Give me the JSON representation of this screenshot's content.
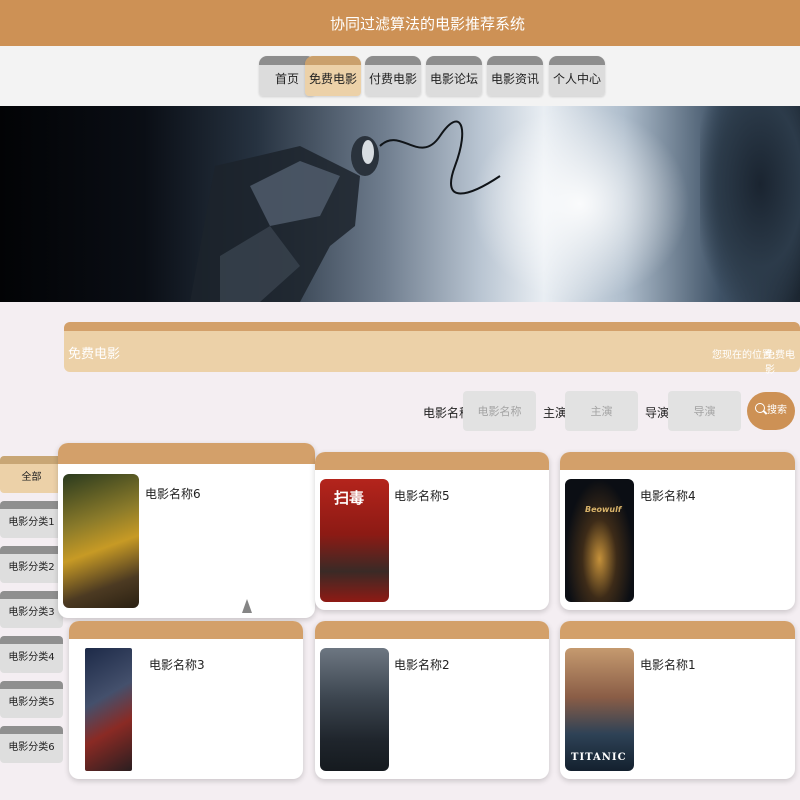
{
  "header": {
    "title": "协同过滤算法的电影推荐系统"
  },
  "nav": {
    "items": [
      {
        "label": "首页"
      },
      {
        "label": "免费电影",
        "active": true
      },
      {
        "label": "付费电影"
      },
      {
        "label": "电影论坛"
      },
      {
        "label": "电影资讯"
      },
      {
        "label": "个人中心"
      }
    ]
  },
  "section": {
    "title": "免费电影",
    "breadcrumb_label": "您现在的位置:",
    "breadcrumb_value": "免费电影"
  },
  "search": {
    "name_label": "电影名称",
    "name_placeholder": "电影名称",
    "actor_label": "主演",
    "actor_placeholder": "主演",
    "director_label": "导演",
    "director_placeholder": "导演",
    "button_label": "搜索"
  },
  "categories": [
    {
      "label": "全部",
      "active": true
    },
    {
      "label": "电影分类1"
    },
    {
      "label": "电影分类2"
    },
    {
      "label": "电影分类3"
    },
    {
      "label": "电影分类4"
    },
    {
      "label": "电影分类5"
    },
    {
      "label": "电影分类6"
    }
  ],
  "movies": [
    {
      "name": "电影名称6"
    },
    {
      "name": "电影名称5",
      "poster_text": "扫毒"
    },
    {
      "name": "电影名称4",
      "poster_text": "Beowulf"
    },
    {
      "name": "电影名称3"
    },
    {
      "name": "电影名称2"
    },
    {
      "name": "电影名称1",
      "poster_text": "TITANIC"
    }
  ],
  "colors": {
    "accent": "#cd9155",
    "tab_active": "#ecd1a8",
    "tab_inactive": "#dcdcdc",
    "background": "#f4eef2"
  }
}
